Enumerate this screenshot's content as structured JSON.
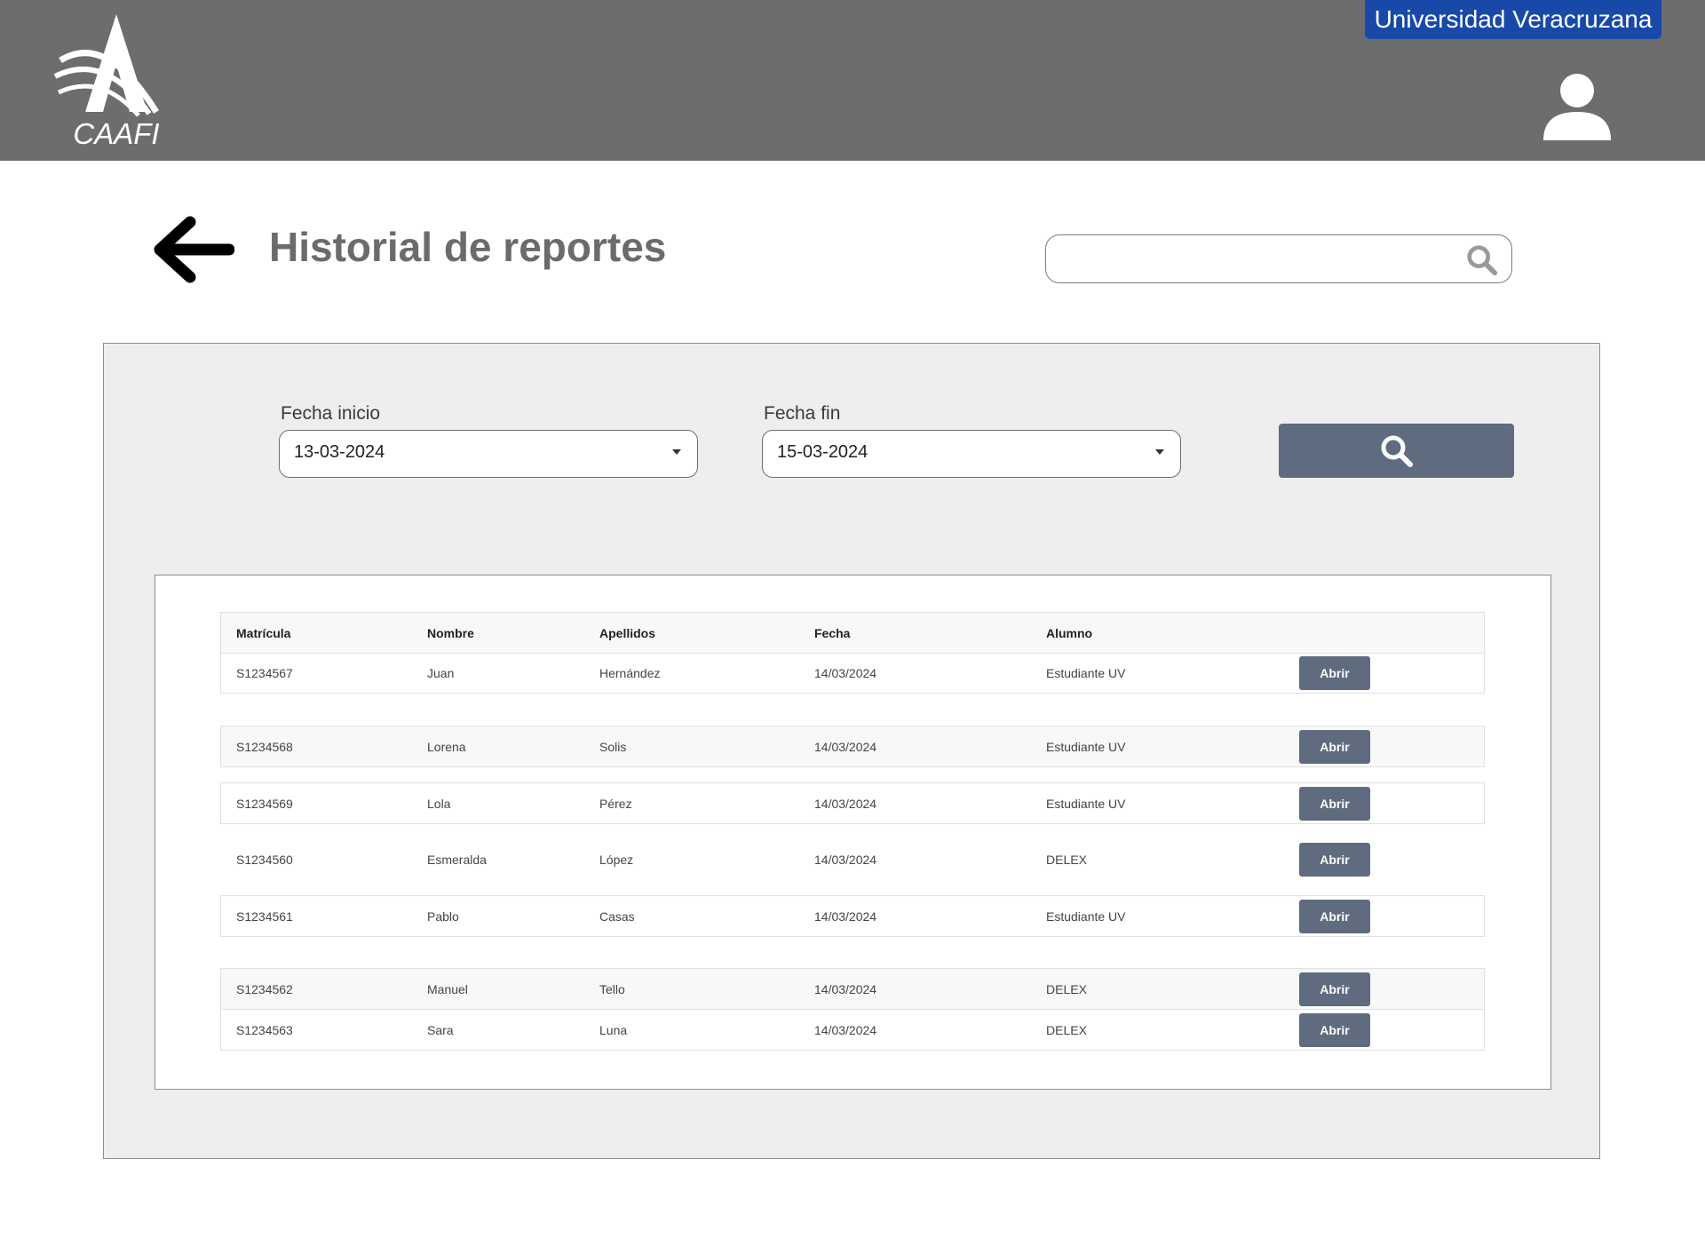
{
  "header": {
    "logo_text": "CAAFI",
    "university_label": "Universidad Veracruzana",
    "icons": {
      "user": "user-icon"
    },
    "colors": {
      "bar": "#6d6d6d",
      "badge": "#1849a9"
    }
  },
  "page": {
    "title": "Historial de reportes",
    "back_icon": "arrow-left-icon",
    "search": {
      "value": "",
      "placeholder": "",
      "icon": "search-icon"
    }
  },
  "filters": {
    "start": {
      "label": "Fecha inicio",
      "value": "13-03-2024"
    },
    "end": {
      "label": "Fecha fin",
      "value": "15-03-2024"
    },
    "search_button_icon": "search-icon",
    "button_color": "#5f6b7e"
  },
  "table": {
    "columns": [
      "Matrícula",
      "Nombre",
      "Apellidos",
      "Fecha",
      "Alumno"
    ],
    "action_label": "Abrir",
    "rows": [
      {
        "matricula": "S1234567",
        "nombre": "Juan",
        "apellidos": "Hernández",
        "fecha": "14/03/2024",
        "alumno": "Estudiante UV"
      },
      {
        "matricula": "S1234568",
        "nombre": "Lorena",
        "apellidos": "Solis",
        "fecha": "14/03/2024",
        "alumno": "Estudiante UV"
      },
      {
        "matricula": "S1234569",
        "nombre": "Lola",
        "apellidos": "Pérez",
        "fecha": "14/03/2024",
        "alumno": "Estudiante UV"
      },
      {
        "matricula": "S1234560",
        "nombre": "Esmeralda",
        "apellidos": "López",
        "fecha": "14/03/2024",
        "alumno": "DELEX"
      },
      {
        "matricula": "S1234561",
        "nombre": "Pablo",
        "apellidos": "Casas",
        "fecha": "14/03/2024",
        "alumno": "Estudiante UV"
      },
      {
        "matricula": "S1234562",
        "nombre": "Manuel",
        "apellidos": "Tello",
        "fecha": "14/03/2024",
        "alumno": "DELEX"
      },
      {
        "matricula": "S1234563",
        "nombre": "Sara",
        "apellidos": "Luna",
        "fecha": "14/03/2024",
        "alumno": "DELEX"
      }
    ]
  }
}
